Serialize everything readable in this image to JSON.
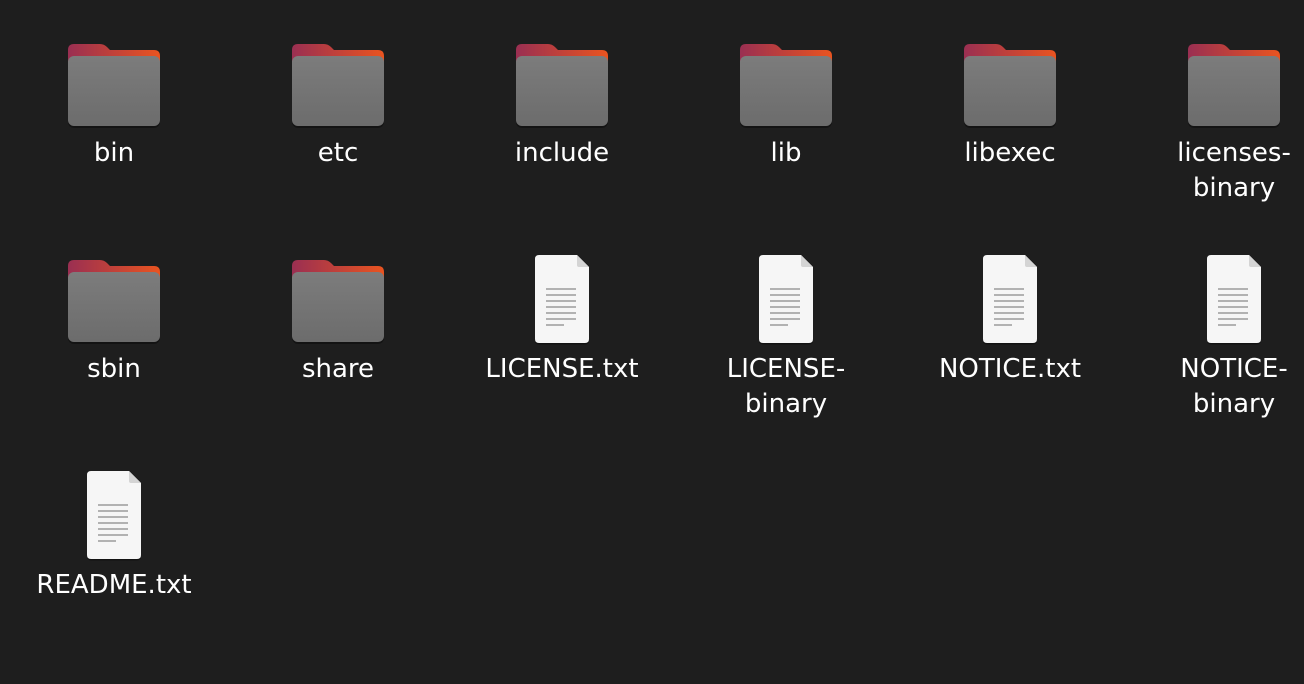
{
  "items": [
    {
      "name": "bin",
      "type": "folder",
      "icon": "folder-icon"
    },
    {
      "name": "etc",
      "type": "folder",
      "icon": "folder-icon"
    },
    {
      "name": "include",
      "type": "folder",
      "icon": "folder-icon"
    },
    {
      "name": "lib",
      "type": "folder",
      "icon": "folder-icon"
    },
    {
      "name": "libexec",
      "type": "folder",
      "icon": "folder-icon"
    },
    {
      "name": "licenses-\nbinary",
      "type": "folder",
      "icon": "folder-icon"
    },
    {
      "name": "sbin",
      "type": "folder",
      "icon": "folder-icon"
    },
    {
      "name": "share",
      "type": "folder",
      "icon": "folder-icon"
    },
    {
      "name": "LICENSE.txt",
      "type": "text-file",
      "icon": "text-file-icon"
    },
    {
      "name": "LICENSE-\nbinary",
      "type": "text-file",
      "icon": "text-file-icon"
    },
    {
      "name": "NOTICE.txt",
      "type": "text-file",
      "icon": "text-file-icon"
    },
    {
      "name": "NOTICE-\nbinary",
      "type": "text-file",
      "icon": "text-file-icon"
    },
    {
      "name": "README.txt",
      "type": "text-file",
      "icon": "text-file-icon"
    }
  ],
  "colors": {
    "background": "#1e1e1e",
    "folder_body": "#747474",
    "folder_tab_start": "#9a2f52",
    "folder_tab_end": "#e95420",
    "file_paper": "#f6f6f6",
    "label": "#ffffff"
  }
}
